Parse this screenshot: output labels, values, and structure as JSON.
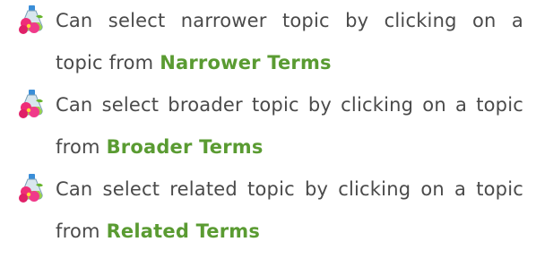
{
  "items": [
    {
      "icon": "flask-flower-icon",
      "line1": "Can select narrower topic by clicking on a",
      "line2_prefix": "topic from",
      "term": "Narrower Terms"
    },
    {
      "icon": "flask-flower-icon",
      "line1": "Can select broader topic by clicking on a topic",
      "line2_prefix": "from",
      "term": "Broader Terms"
    },
    {
      "icon": "flask-flower-icon",
      "line1": "Can select related topic by clicking on a topic",
      "line2_prefix": "from",
      "term": "Related Terms"
    }
  ],
  "colors": {
    "text": "#4a4a4a",
    "term": "#5a9b32"
  }
}
